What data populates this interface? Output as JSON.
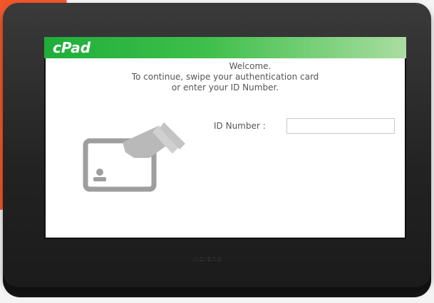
{
  "device": {
    "brand_plate": "Inbrand",
    "screen": {
      "app_title": "cPad",
      "welcome_line1": "Welcome.",
      "welcome_line2": "To continue, swipe your authentication card",
      "welcome_line3": "or enter your ID Number.",
      "id_label": "ID Number :",
      "id_value": "",
      "id_placeholder": ""
    }
  },
  "colors": {
    "header_green": "#3fbf4b",
    "accent_orange": "#f0572a",
    "bezel": "#2a2a2a"
  },
  "icons": [
    "card-swipe-icon",
    "user-icon"
  ]
}
